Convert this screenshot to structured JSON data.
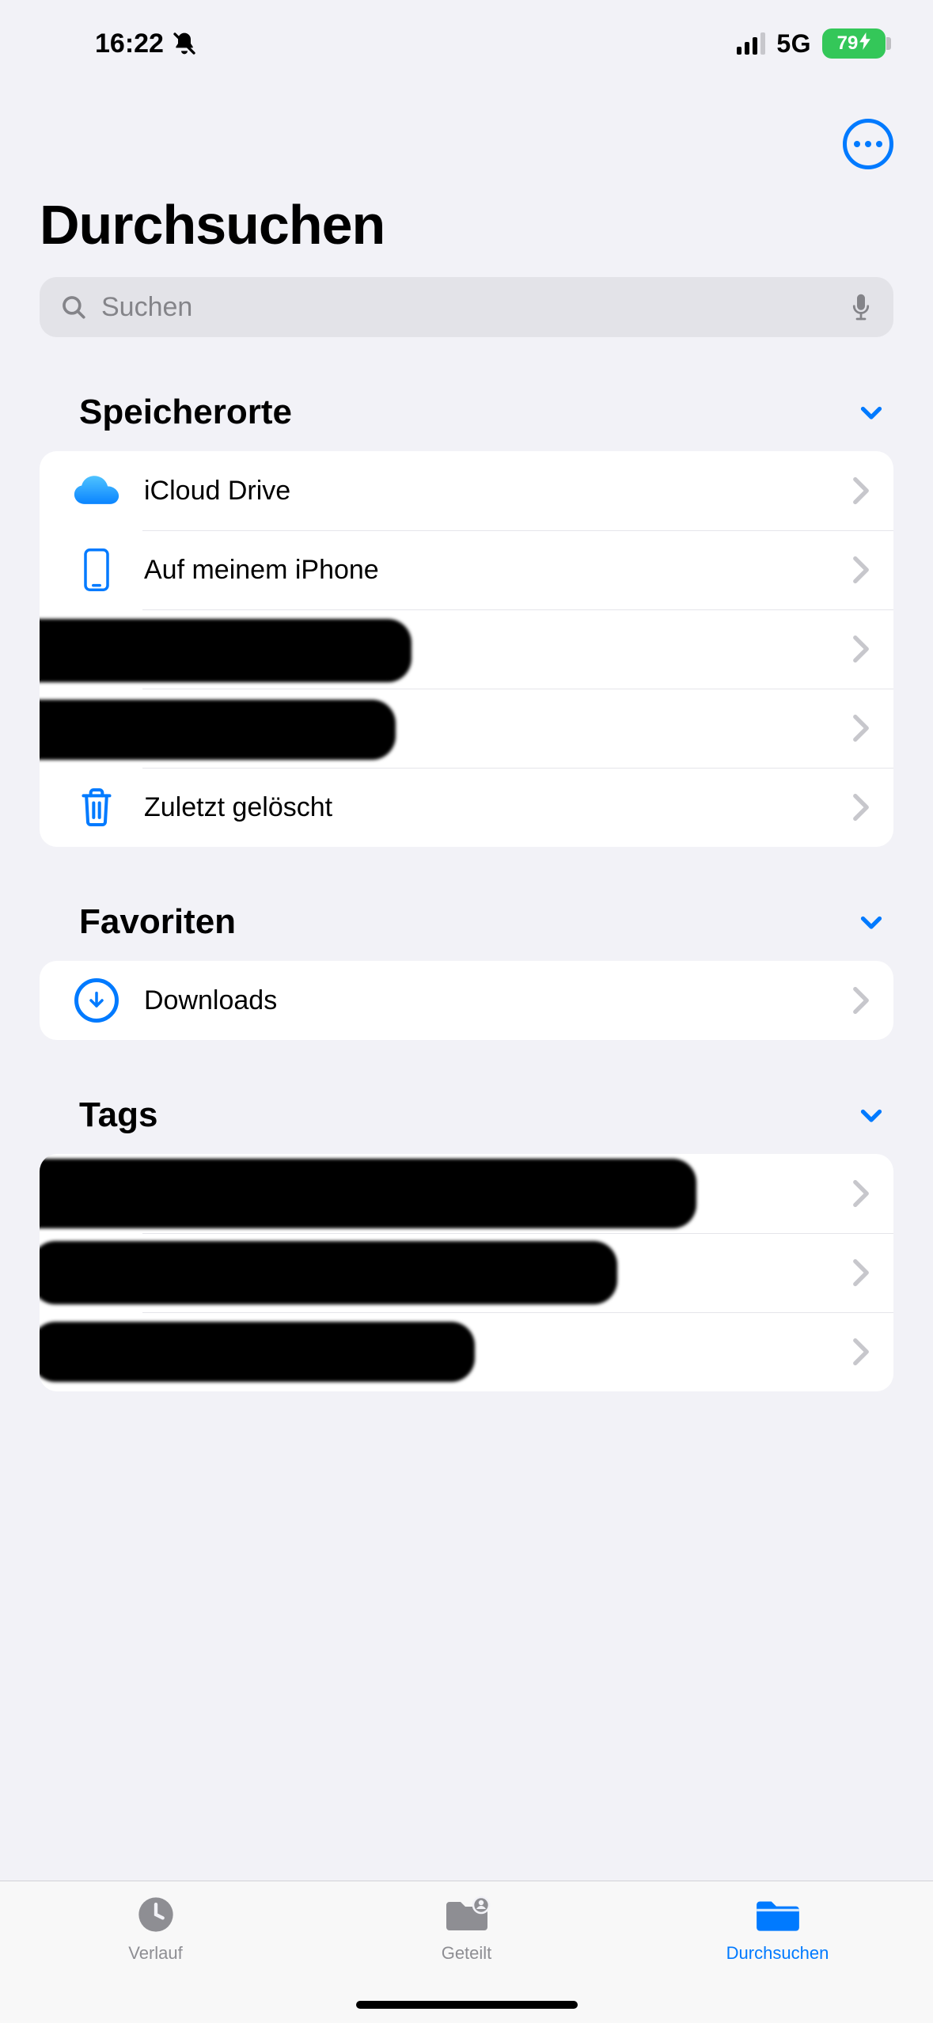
{
  "status": {
    "time": "16:22",
    "network_label": "5G",
    "battery_percent": "79"
  },
  "header": {
    "title": "Durchsuchen"
  },
  "search": {
    "placeholder": "Suchen"
  },
  "sections": {
    "locations": {
      "title": "Speicherorte",
      "items": [
        {
          "label": "iCloud Drive"
        },
        {
          "label": "Auf meinem iPhone"
        },
        {
          "label": ""
        },
        {
          "label": ""
        },
        {
          "label": "Zuletzt gelöscht"
        }
      ]
    },
    "favorites": {
      "title": "Favoriten",
      "items": [
        {
          "label": "Downloads"
        }
      ]
    },
    "tags": {
      "title": "Tags",
      "items": [
        {
          "label": ""
        },
        {
          "label": ""
        },
        {
          "label": ""
        }
      ]
    }
  },
  "tabbar": {
    "items": [
      {
        "label": "Verlauf"
      },
      {
        "label": "Geteilt"
      },
      {
        "label": "Durchsuchen"
      }
    ],
    "active_index": 2
  },
  "colors": {
    "tint": "#007aff",
    "background": "#f2f2f7",
    "card": "#ffffff",
    "separator": "#e5e5ea",
    "secondary_label": "#8e8e93",
    "battery_green": "#34c759"
  }
}
